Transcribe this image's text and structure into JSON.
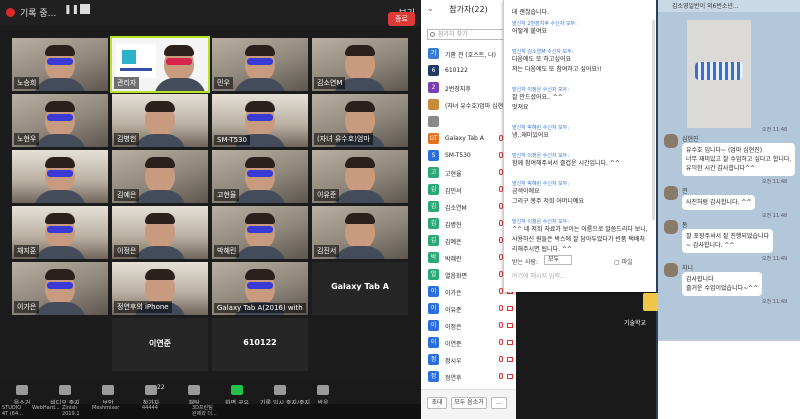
{
  "meeting": {
    "recording_label": "기록 중...",
    "view_label": "보기",
    "participants": [
      {
        "name": "노승희",
        "style": "cam"
      },
      {
        "name": "관리자",
        "style": "speaker"
      },
      {
        "name": "민우",
        "style": "cam"
      },
      {
        "name": "김소연M",
        "style": "cam"
      },
      {
        "name": "노현우",
        "style": "cam"
      },
      {
        "name": "김병헌",
        "style": "cam2"
      },
      {
        "name": "SM-T530",
        "style": "cam2"
      },
      {
        "name": "(자녀 유수호)엄마",
        "style": "cam"
      },
      {
        "name": "",
        "style": "cam2"
      },
      {
        "name": "김예은",
        "style": "cam"
      },
      {
        "name": "고현율",
        "style": "cam"
      },
      {
        "name": "이유준",
        "style": "cam"
      },
      {
        "name": "채지훈",
        "style": "cam2"
      },
      {
        "name": "이정은",
        "style": "cam2"
      },
      {
        "name": "박혜린",
        "style": "cam"
      },
      {
        "name": "김진서",
        "style": "cam"
      },
      {
        "name": "이가은",
        "style": "cam"
      },
      {
        "name": "정연후의 iPhone",
        "style": "cam2"
      },
      {
        "name": "Galaxy Tab A(2016) with",
        "style": "cam"
      },
      {
        "name": "Galaxy Tab A",
        "style": "dark",
        "center": true
      },
      {
        "name": "",
        "style": "none"
      },
      {
        "name": "이연준",
        "style": "dark",
        "center": true
      },
      {
        "name": "610122",
        "style": "dark",
        "center": true
      },
      {
        "name": "",
        "style": "none"
      }
    ],
    "toolbar": [
      {
        "label": "음소거",
        "icon": "mic-icon"
      },
      {
        "label": "비디오 중지",
        "icon": "video-icon"
      },
      {
        "label": "보안",
        "icon": "shield-icon"
      },
      {
        "label": "참가자",
        "icon": "participants-icon",
        "count": "22"
      },
      {
        "label": "채팅",
        "icon": "chat-icon"
      },
      {
        "label": "화면 공유",
        "icon": "share-screen-icon",
        "green": true
      },
      {
        "label": "기록 일시 중지/중지",
        "icon": "record-icon"
      },
      {
        "label": "반응",
        "icon": "reaction-icon"
      }
    ],
    "end_label": "종료"
  },
  "participants_panel": {
    "title": "참가자(22)",
    "search_placeholder": "참가자 찾기",
    "list": [
      {
        "name": "기환 전 (호스트, 나)",
        "initial": "기",
        "color": "#3a7bd5"
      },
      {
        "name": "610122",
        "initial": "6",
        "color": "#1f3b66"
      },
      {
        "name": "2번장지후",
        "initial": "2",
        "color": "#7a3fb0"
      },
      {
        "name": "(자녀 유수호)엄마 심현진",
        "initial": "",
        "color": "#c98a3a"
      },
      {
        "name": "",
        "initial": "",
        "color": "#8a8a8a"
      },
      {
        "name": "Galaxy Tab A",
        "initial": "GT",
        "color": "#e2711d"
      },
      {
        "name": "SM-T530",
        "initial": "S",
        "color": "#2a6fdb"
      },
      {
        "name": "고현율",
        "initial": "고",
        "color": "#2aa876"
      },
      {
        "name": "김민서",
        "initial": "김",
        "color": "#2aa876"
      },
      {
        "name": "김소연M",
        "initial": "김",
        "color": "#2aa876"
      },
      {
        "name": "김병헌",
        "initial": "김",
        "color": "#2aa876"
      },
      {
        "name": "김예은",
        "initial": "김",
        "color": "#2aa876"
      },
      {
        "name": "박혜린",
        "initial": "박",
        "color": "#2aa876"
      },
      {
        "name": "열음화면",
        "initial": "열",
        "color": "#2aa876"
      },
      {
        "name": "이가은",
        "initial": "이",
        "color": "#2a6fdb"
      },
      {
        "name": "이유준",
        "initial": "이",
        "color": "#2a6fdb"
      },
      {
        "name": "이정은",
        "initial": "이",
        "color": "#2a6fdb"
      },
      {
        "name": "이연준",
        "initial": "이",
        "color": "#2a6fdb"
      },
      {
        "name": "정시우",
        "initial": "정",
        "color": "#2a6fdb"
      },
      {
        "name": "정연후",
        "initial": "정",
        "color": "#2a6fdb"
      }
    ],
    "invite_label": "초대",
    "mute_all_label": "모두 음소거",
    "more_label": "..."
  },
  "chat": {
    "first_line": "데 괜찮습니다.",
    "messages": [
      {
        "from": "발신자 2번장지후 수신자 모두:",
        "text": "어떻게 붙여요"
      },
      {
        "from": "발신자 김소연M 수신자 모두:",
        "text": "다음에도 또 하고싶어요\n저는 다음에도 또 참여하고 싶어요!!"
      },
      {
        "from": "발신자 이정은 수신자 모두:",
        "text": "잘 만드셨어요.. ^^\n멋져요"
      },
      {
        "from": "발신자 박혜린 수신자 모두:",
        "text": "넹..재미있어요"
      },
      {
        "from": "발신자 이정은 수신자 모두:",
        "text": "함께 참여해주셔서 즐겁운 시간입니다. ^^"
      },
      {
        "from": "발신자 박혜린 수신자 모두:",
        "text": "금색이에요\n그리구 봉주 저희 어머니예요"
      },
      {
        "from": "발신자 이정은 수신자 모두:",
        "text": "^^ 네 저희 자료가 보이는 이름으로 말씀드리다 보니,\n사용하신 원들은 박스에 잘 담아두었다가 반품 택배처리해주시면 됩니다. ^^"
      }
    ],
    "to_label": "받는 사람:",
    "to_value": "모두",
    "file_label": "파일",
    "input_placeholder": "여기에 메시지 입력..."
  },
  "desktop": {
    "icon_label": "기술학교"
  },
  "kakao": {
    "title": "김소영일반이 외6번소년...",
    "items": [
      {
        "kind": "time",
        "text": "오전 11:48"
      },
      {
        "kind": "name",
        "text": "심현진"
      },
      {
        "kind": "bubble",
        "text": "유수호 입니다~ (엄마 심현진)\n너무 재미있고 잘 수업하고 싶다고 합니다.\n유익한 시간 감사합니다^^"
      },
      {
        "kind": "time",
        "text": "오전 11:48"
      },
      {
        "kind": "name",
        "text": "전"
      },
      {
        "kind": "bubble",
        "text": "사진처럼 감사합니다. ^^"
      },
      {
        "kind": "time",
        "text": "오전 11:48"
      },
      {
        "kind": "name",
        "text": "동"
      },
      {
        "kind": "bubble",
        "text": "잘 포장주셔서 잘 진행되었습니다\n~ 감사합니다. ^^"
      },
      {
        "kind": "time",
        "text": "오전 11:49"
      },
      {
        "kind": "name",
        "text": "지니"
      },
      {
        "kind": "bubble",
        "text": "감사합니다\n즐거운 수업이었습니다~^^"
      },
      {
        "kind": "time",
        "text": "오전 11:49"
      }
    ]
  },
  "taskbar": [
    {
      "line1": "STUDIO",
      "line2": "4T (64..."
    },
    {
      "line1": "WebHard...",
      "line2": ""
    },
    {
      "line1": "Zinish",
      "line2": "2019.1"
    },
    {
      "line1": "Meshmixer",
      "line2": ""
    },
    {
      "line1": "44444",
      "line2": ""
    },
    {
      "line1": "3D프린팅",
      "line2": "완제와 더..."
    }
  ]
}
